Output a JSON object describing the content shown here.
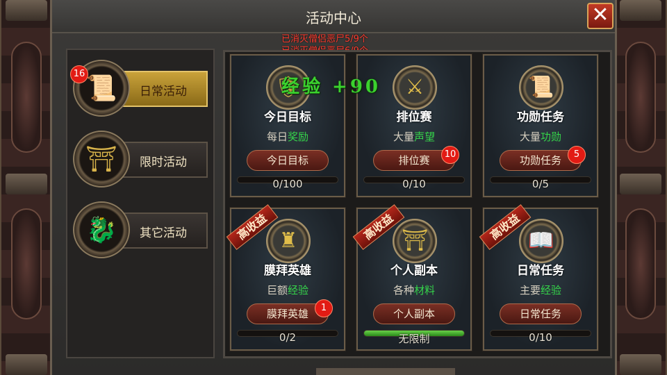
{
  "window": {
    "title": "活动中心",
    "close_label": "✕"
  },
  "notices": [
    "已消灭僧侣恶尸5/9个",
    "已消灭僧侣恶尸6/9个"
  ],
  "reward_float": "经验 +90",
  "tabs": [
    {
      "label": "日常活动",
      "icon": "scroll-icon",
      "glyph": "📜",
      "badge": "16",
      "active": true
    },
    {
      "label": "限时活动",
      "icon": "altar-icon",
      "glyph": "⛩",
      "badge": "",
      "active": false
    },
    {
      "label": "其它活动",
      "icon": "dragon-head-icon",
      "glyph": "🐉",
      "badge": "",
      "active": false
    }
  ],
  "cards": [
    {
      "name": "今日目标",
      "icon": "shield-icon",
      "glyph": "🛡",
      "desc_prefix": "每日",
      "desc_highlight": "奖励",
      "button": "今日目标",
      "badge": "",
      "progress_text": "0/100",
      "progress": 0,
      "ribbon": ""
    },
    {
      "name": "排位赛",
      "icon": "sword-book-icon",
      "glyph": "⚔",
      "desc_prefix": "大量",
      "desc_highlight": "声望",
      "button": "排位赛",
      "badge": "10",
      "progress_text": "0/10",
      "progress": 0,
      "ribbon": ""
    },
    {
      "name": "功勋任务",
      "icon": "scroll-icon",
      "glyph": "📜",
      "desc_prefix": "大量",
      "desc_highlight": "功勋",
      "button": "功勋任务",
      "badge": "5",
      "progress_text": "0/5",
      "progress": 0,
      "ribbon": ""
    },
    {
      "name": "膜拜英雄",
      "icon": "armor-icon",
      "glyph": "♜",
      "desc_prefix": "巨额",
      "desc_highlight": "经验",
      "button": "膜拜英雄",
      "badge": "1",
      "progress_text": "0/2",
      "progress": 0,
      "ribbon": "高收益"
    },
    {
      "name": "个人副本",
      "icon": "altar-icon",
      "glyph": "⛩",
      "desc_prefix": "各种",
      "desc_highlight": "材料",
      "button": "个人副本",
      "badge": "",
      "progress_text": "无限制",
      "progress": 1,
      "ribbon": "高收益"
    },
    {
      "name": "日常任务",
      "icon": "book-icon",
      "glyph": "📖",
      "desc_prefix": "主要",
      "desc_highlight": "经验",
      "button": "日常任务",
      "badge": "",
      "progress_text": "0/10",
      "progress": 0,
      "ribbon": "高收益"
    }
  ],
  "colors": {
    "highlight": "#35d44a",
    "notice": "#ff3b2e",
    "badge": "#e21b14",
    "active_tab": "#c9a23a"
  }
}
